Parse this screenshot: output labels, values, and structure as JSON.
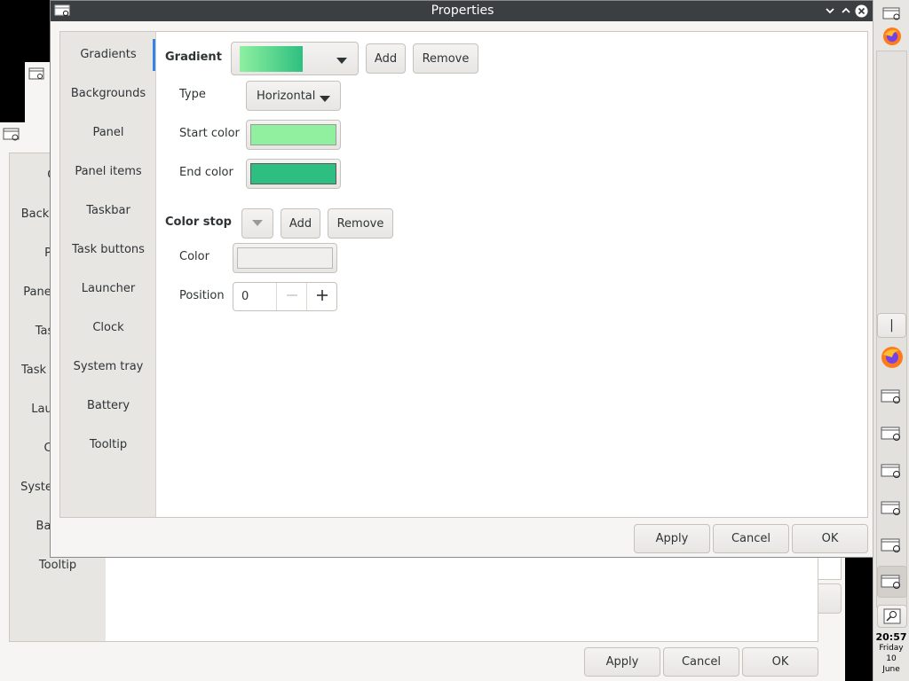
{
  "colors": {
    "accent": "#3584e4",
    "gradient_from": "#8ef0a0",
    "gradient_to": "#2ebf80",
    "start_color": "#90f0a0",
    "end_color": "#2ebe82"
  },
  "background_window": {
    "title_icon": "window-menu-icon",
    "sidebar": [
      "Gra",
      "Back",
      "P",
      "Pane",
      "Tas",
      "Task",
      "Lau",
      "C",
      "Syste",
      "Ba",
      "Tooltip"
    ],
    "buttons": {
      "apply": "Apply",
      "cancel": "Cancel",
      "ok": "OK"
    }
  },
  "dialog": {
    "title": "Properties",
    "titlebar_icons": [
      "window-menu-icon",
      "chevron-down-icon",
      "chevron-up-icon",
      "close-icon"
    ],
    "sidebar": [
      "Gradients",
      "Backgrounds",
      "Panel",
      "Panel items",
      "Taskbar",
      "Task buttons",
      "Launcher",
      "Clock",
      "System tray",
      "Battery",
      "Tooltip"
    ],
    "selected_sidebar_index": 0,
    "gradient": {
      "label": "Gradient",
      "add_label": "Add",
      "remove_label": "Remove",
      "type_label": "Type",
      "type_value": "Horizontal",
      "start_color_label": "Start color",
      "end_color_label": "End color"
    },
    "color_stop": {
      "label": "Color stop",
      "add_label": "Add",
      "remove_label": "Remove",
      "color_label": "Color",
      "position_label": "Position",
      "position_value": "0"
    },
    "buttons": {
      "apply": "Apply",
      "cancel": "Cancel",
      "ok": "OK"
    }
  },
  "taskbar": {
    "separator": "|",
    "icons": [
      "window-icon",
      "firefox-icon",
      "firefox-icon",
      "window-icon",
      "window-icon",
      "window-icon",
      "window-icon",
      "window-icon",
      "window-icon",
      "search-icon"
    ],
    "clock": {
      "time": "20:57",
      "day": "Friday",
      "date": "10",
      "month": "June"
    }
  }
}
